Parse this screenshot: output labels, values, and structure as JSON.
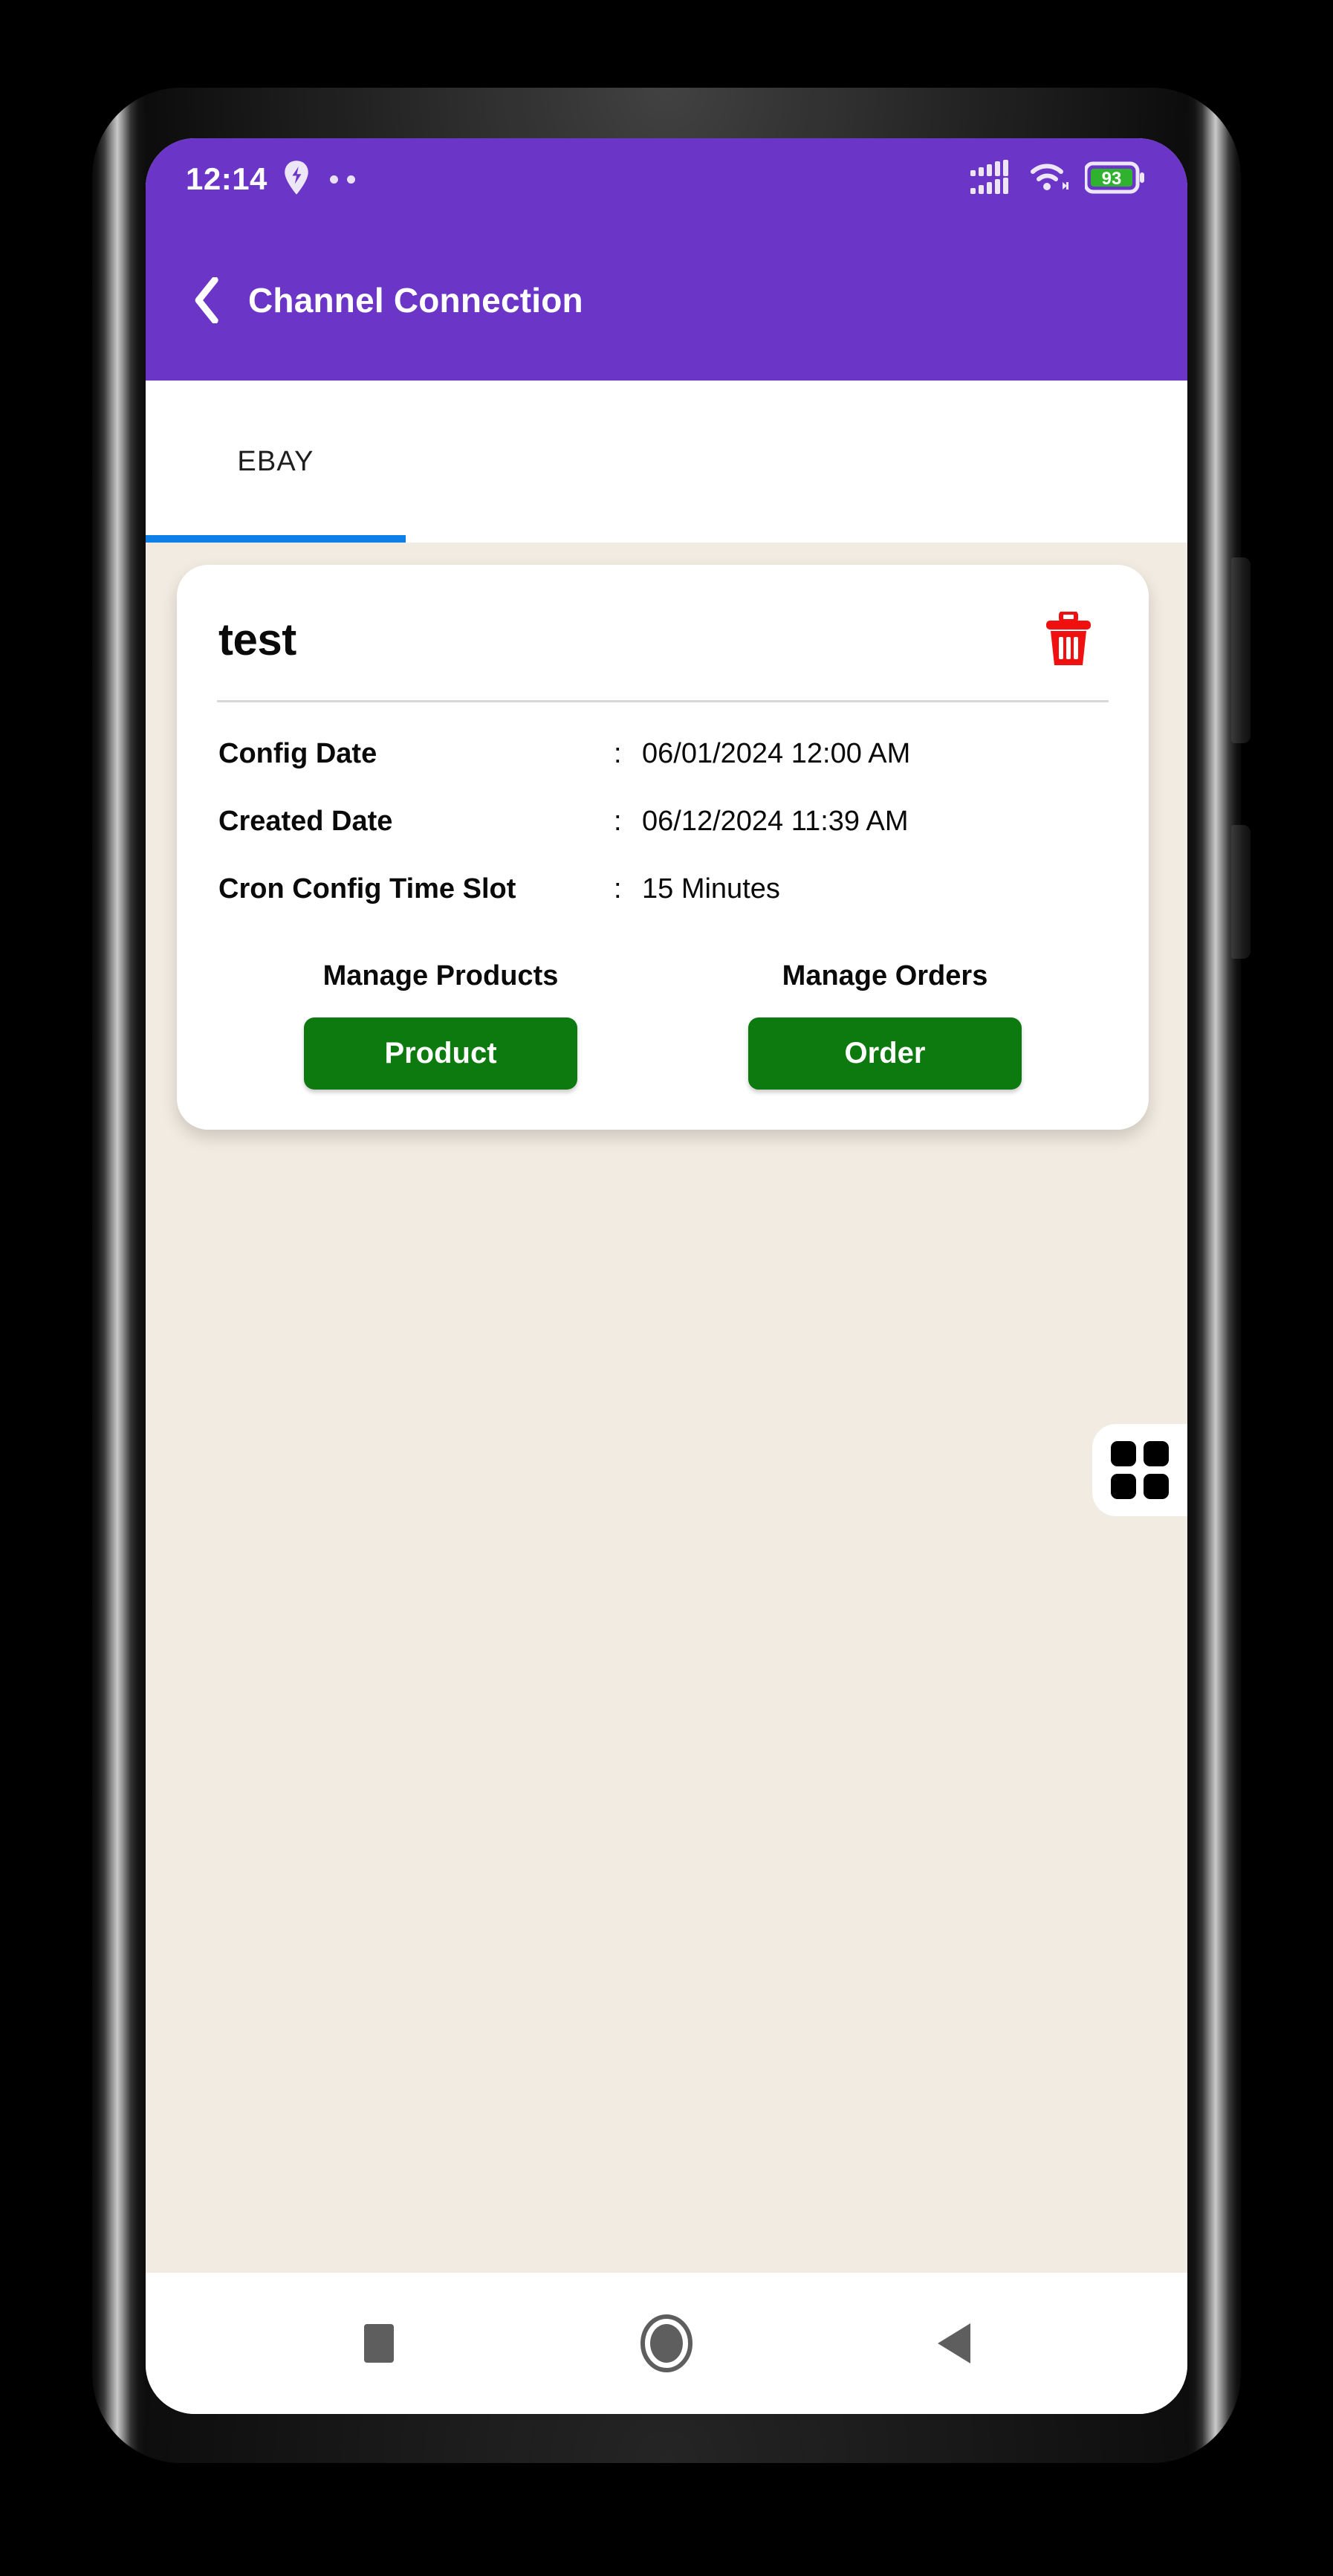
{
  "status_bar": {
    "time": "12:14",
    "battery_level": "93",
    "icons": [
      "location-pin-icon",
      "dot-icon",
      "dot-icon",
      "signal-bars-icon",
      "wifi-icon",
      "battery-icon"
    ]
  },
  "app_bar": {
    "title": "Channel Connection",
    "back_label": "Back"
  },
  "tabs": [
    {
      "label": "EBAY",
      "selected": true
    }
  ],
  "card": {
    "title": "test",
    "delete_label": "Delete",
    "details": [
      {
        "label": "Config Date",
        "separator": ":",
        "value": "06/01/2024 12:00 AM"
      },
      {
        "label": "Created Date",
        "separator": ":",
        "value": "06/12/2024 11:39 AM"
      },
      {
        "label": "Cron Config Time Slot",
        "separator": ":",
        "value": "15 Minutes"
      }
    ],
    "actions": [
      {
        "title": "Manage Products",
        "button_label": "Product"
      },
      {
        "title": "Manage Orders",
        "button_label": "Order"
      }
    ]
  },
  "grid_widget": {
    "label": "App grid"
  },
  "nav_bar": {
    "recents_label": "Recents",
    "home_label": "Home",
    "back_label": "Back"
  },
  "colors": {
    "app_bar": "#6B35C8",
    "tab_indicator": "#0C80E8",
    "background": "#F2EBE1",
    "card": "#FFFFFF",
    "action_button": "#0C7A0E",
    "delete_icon": "#F01010",
    "battery_fill": "#2FB32F"
  }
}
